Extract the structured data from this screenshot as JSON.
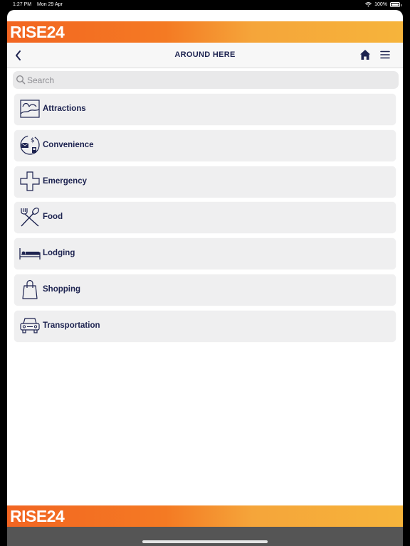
{
  "status": {
    "time": "1:27 PM",
    "date": "Mon 29 Apr",
    "battery": "100%",
    "battery_level": 1.0
  },
  "brand": {
    "logo": "RISE24"
  },
  "nav": {
    "title": "AROUND HERE"
  },
  "search": {
    "placeholder": "Search",
    "value": ""
  },
  "categories": [
    {
      "label": "Attractions",
      "icon": "landscape-icon"
    },
    {
      "label": "Convenience",
      "icon": "convenience-icon"
    },
    {
      "label": "Emergency",
      "icon": "cross-icon"
    },
    {
      "label": "Food",
      "icon": "fork-spoon-icon"
    },
    {
      "label": "Lodging",
      "icon": "bed-icon"
    },
    {
      "label": "Shopping",
      "icon": "shopping-bag-icon"
    },
    {
      "label": "Transportation",
      "icon": "car-icon"
    }
  ],
  "colors": {
    "brand_orange": "#f26522",
    "brand_yellow": "#f6b43b",
    "navy": "#1d2350"
  }
}
